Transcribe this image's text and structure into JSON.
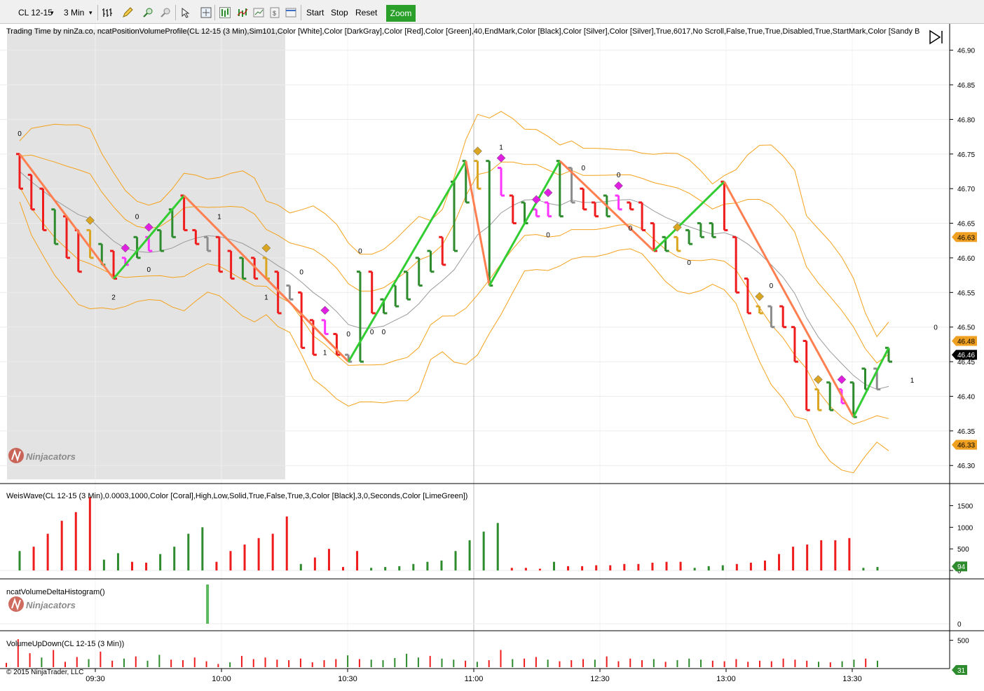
{
  "toolbar": {
    "instrument": "CL 12-15",
    "timeframe": "3 Min",
    "buttons": [
      {
        "name": "start-button",
        "label": "Start"
      },
      {
        "name": "stop-button",
        "label": "Stop"
      },
      {
        "name": "reset-button",
        "label": "Reset"
      },
      {
        "name": "zoom-button",
        "label": "Zoom"
      }
    ],
    "icons": [
      "bar-type-icon",
      "drawing-pencil-icon",
      "zoom-in-icon",
      "zoom-out-icon",
      "cursor-icon",
      "crosshair-icon",
      "chart-style-icon",
      "indicators-icon",
      "strategies-icon",
      "data-box-icon",
      "properties-icon"
    ]
  },
  "panels": {
    "price_title": "Trading Time by ninZa.co, ncatPositionVolumeProfile(CL 12-15 (3 Min),Sim101,Color [White],Color [DarkGray],Color [Red],Color [Green],40,EndMark,Color [Black],Color [Silver],Color [Silver],True,6017,No Scroll,False,True,True,Disabled,True,StartMark,Color [Sandy B",
    "weis_title": "WeisWave(CL 12-15 (3 Min),0.0003,1000,Color [Coral],High,Low,Solid,True,False,True,3,Color [Black],3,0,Seconds,Color [LimeGreen])",
    "delta_title": "ncatVolumeDeltaHistogram()",
    "updown_title": "VolumeUpDown(CL 12-15 (3 Min))",
    "watermark": "Ninjacators",
    "copyright": "© 2015 NinjaTrader, LLC"
  },
  "colors": {
    "up": "#2e8b2e",
    "down": "#ee1c1c",
    "wave_up": "#32cd32",
    "wave_down": "#ff7f50",
    "band": "#f4a21c",
    "ma": "#9a9a9a",
    "gold": "#daa520",
    "magenta": "#ff33ff",
    "gray": "#8c8c8c",
    "session_shade": "#e3e3e3"
  },
  "chart_data": [
    {
      "type": "ohlc",
      "name": "price",
      "x_labels": [
        "09:30",
        "10:00",
        "10:30",
        "11:00",
        "12:30",
        "13:00",
        "13:30"
      ],
      "y_ticks": [
        46.3,
        46.35,
        46.4,
        46.45,
        46.5,
        46.55,
        46.6,
        46.65,
        46.7,
        46.75,
        46.8,
        46.85,
        46.9
      ],
      "y_range": [
        46.28,
        46.93
      ],
      "price_markers": [
        {
          "label": "46.63",
          "value": 46.63,
          "style": "gold"
        },
        {
          "label": "46.48",
          "value": 46.48,
          "style": "gold"
        },
        {
          "label": "46.46",
          "value": 46.46,
          "style": "dark"
        },
        {
          "label": "46.33",
          "value": 46.33,
          "style": "gold"
        }
      ],
      "bars": [
        {
          "h": 46.75,
          "l": 46.7,
          "c": "red"
        },
        {
          "h": 46.72,
          "l": 46.67,
          "c": "red"
        },
        {
          "h": 46.7,
          "l": 46.64,
          "c": "red"
        },
        {
          "h": 46.67,
          "l": 46.62,
          "c": "green"
        },
        {
          "h": 46.66,
          "l": 46.6,
          "c": "red"
        },
        {
          "h": 46.64,
          "l": 46.58,
          "c": "red"
        },
        {
          "h": 46.64,
          "l": 46.6,
          "c": "gold"
        },
        {
          "h": 46.62,
          "l": 46.59,
          "c": "green"
        },
        {
          "h": 46.61,
          "l": 46.57,
          "c": "red"
        },
        {
          "h": 46.6,
          "l": 46.59,
          "c": "magenta"
        },
        {
          "h": 46.63,
          "l": 46.6,
          "c": "green"
        },
        {
          "h": 46.63,
          "l": 46.61,
          "c": "magenta"
        },
        {
          "h": 46.64,
          "l": 46.61,
          "c": "green"
        },
        {
          "h": 46.67,
          "l": 46.63,
          "c": "green"
        },
        {
          "h": 46.69,
          "l": 46.64,
          "c": "red"
        },
        {
          "h": 46.64,
          "l": 46.62,
          "c": "red"
        },
        {
          "h": 46.63,
          "l": 46.61,
          "c": "gray"
        },
        {
          "h": 46.63,
          "l": 46.58,
          "c": "red"
        },
        {
          "h": 46.61,
          "l": 46.57,
          "c": "red"
        },
        {
          "h": 46.6,
          "l": 46.57,
          "c": "green"
        },
        {
          "h": 46.6,
          "l": 46.57,
          "c": "red"
        },
        {
          "h": 46.6,
          "l": 46.57,
          "c": "gold"
        },
        {
          "h": 46.58,
          "l": 46.52,
          "c": "red"
        },
        {
          "h": 46.56,
          "l": 46.54,
          "c": "gray"
        },
        {
          "h": 46.55,
          "l": 46.47,
          "c": "red"
        },
        {
          "h": 46.51,
          "l": 46.46,
          "c": "red"
        },
        {
          "h": 46.51,
          "l": 46.49,
          "c": "magenta"
        },
        {
          "h": 46.49,
          "l": 46.46,
          "c": "red"
        },
        {
          "h": 46.46,
          "l": 46.45,
          "c": "gray"
        },
        {
          "h": 46.58,
          "l": 46.45,
          "c": "green"
        },
        {
          "h": 46.58,
          "l": 46.52,
          "c": "red"
        },
        {
          "h": 46.54,
          "l": 46.52,
          "c": "green"
        },
        {
          "h": 46.56,
          "l": 46.53,
          "c": "green"
        },
        {
          "h": 46.58,
          "l": 46.54,
          "c": "green"
        },
        {
          "h": 46.6,
          "l": 46.56,
          "c": "green"
        },
        {
          "h": 46.61,
          "l": 46.58,
          "c": "green"
        },
        {
          "h": 46.63,
          "l": 46.59,
          "c": "red"
        },
        {
          "h": 46.71,
          "l": 46.61,
          "c": "green"
        },
        {
          "h": 46.74,
          "l": 46.68,
          "c": "green"
        },
        {
          "h": 46.74,
          "l": 46.7,
          "c": "gold"
        },
        {
          "h": 46.74,
          "l": 46.56,
          "c": "green"
        },
        {
          "h": 46.73,
          "l": 46.69,
          "c": "magenta"
        },
        {
          "h": 46.69,
          "l": 46.65,
          "c": "red"
        },
        {
          "h": 46.68,
          "l": 46.65,
          "c": "green"
        },
        {
          "h": 46.67,
          "l": 46.66,
          "c": "magenta"
        },
        {
          "h": 46.68,
          "l": 46.66,
          "c": "magenta"
        },
        {
          "h": 46.74,
          "l": 46.66,
          "c": "green"
        },
        {
          "h": 46.73,
          "l": 46.68,
          "c": "gray"
        },
        {
          "h": 46.7,
          "l": 46.67,
          "c": "red"
        },
        {
          "h": 46.68,
          "l": 46.66,
          "c": "red"
        },
        {
          "h": 46.69,
          "l": 46.66,
          "c": "green"
        },
        {
          "h": 46.69,
          "l": 46.67,
          "c": "magenta"
        },
        {
          "h": 46.68,
          "l": 46.67,
          "c": "red"
        },
        {
          "h": 46.68,
          "l": 46.64,
          "c": "red"
        },
        {
          "h": 46.65,
          "l": 46.61,
          "c": "red"
        },
        {
          "h": 46.63,
          "l": 46.61,
          "c": "green"
        },
        {
          "h": 46.63,
          "l": 46.61,
          "c": "gold"
        },
        {
          "h": 46.64,
          "l": 46.62,
          "c": "green"
        },
        {
          "h": 46.65,
          "l": 46.63,
          "c": "green"
        },
        {
          "h": 46.65,
          "l": 46.63,
          "c": "green"
        },
        {
          "h": 46.71,
          "l": 46.64,
          "c": "red"
        },
        {
          "h": 46.63,
          "l": 46.55,
          "c": "red"
        },
        {
          "h": 46.57,
          "l": 46.52,
          "c": "red"
        },
        {
          "h": 46.53,
          "l": 46.52,
          "c": "gold"
        },
        {
          "h": 46.53,
          "l": 46.5,
          "c": "gray"
        },
        {
          "h": 46.53,
          "l": 46.5,
          "c": "red"
        },
        {
          "h": 46.5,
          "l": 46.45,
          "c": "red"
        },
        {
          "h": 46.48,
          "l": 46.38,
          "c": "red"
        },
        {
          "h": 46.41,
          "l": 46.38,
          "c": "gold"
        },
        {
          "h": 46.42,
          "l": 46.38,
          "c": "green"
        },
        {
          "h": 46.41,
          "l": 46.39,
          "c": "magenta"
        },
        {
          "h": 46.42,
          "l": 46.37,
          "c": "green"
        },
        {
          "h": 46.44,
          "l": 46.41,
          "c": "green"
        },
        {
          "h": 46.44,
          "l": 46.41,
          "c": "gray"
        },
        {
          "h": 46.47,
          "l": 46.45,
          "c": "green"
        }
      ],
      "wave_counts": [
        {
          "bar": 0,
          "label": "0",
          "pos": "above"
        },
        {
          "bar": 8,
          "label": "2",
          "pos": "below"
        },
        {
          "bar": 10,
          "label": "0",
          "pos": "above"
        },
        {
          "bar": 11,
          "label": "0",
          "pos": "below"
        },
        {
          "bar": 17,
          "label": "1",
          "pos": "above"
        },
        {
          "bar": 26,
          "label": "1",
          "pos": "below"
        },
        {
          "bar": 29,
          "label": "0",
          "pos": "above"
        },
        {
          "bar": 24,
          "label": "0",
          "pos": "above"
        },
        {
          "bar": 31,
          "label": "0",
          "pos": "below"
        },
        {
          "bar": 28,
          "label": "0",
          "pos": "above"
        },
        {
          "bar": 30,
          "label": "0",
          "pos": "below"
        },
        {
          "bar": 41,
          "label": "1",
          "pos": "above"
        },
        {
          "bar": 45,
          "label": "0",
          "pos": "below"
        },
        {
          "bar": 48,
          "label": "0",
          "pos": "above"
        },
        {
          "bar": 51,
          "label": "0",
          "pos": "above"
        },
        {
          "bar": 52,
          "label": "0",
          "pos": "below"
        },
        {
          "bar": 57,
          "label": "0",
          "pos": "below"
        },
        {
          "bar": 64,
          "label": "0",
          "pos": "above"
        },
        {
          "bar": 76,
          "label": "1",
          "pos": "below"
        },
        {
          "bar": 78,
          "label": "0",
          "pos": "above"
        },
        {
          "bar": 21,
          "label": "1",
          "pos": "below"
        }
      ]
    },
    {
      "type": "bar",
      "name": "WeisWave",
      "y_ticks": [
        0,
        500,
        1000,
        1500
      ],
      "value_marker": 94,
      "values": [
        {
          "v": 450,
          "c": "green"
        },
        {
          "v": 550,
          "c": "red"
        },
        {
          "v": 850,
          "c": "red"
        },
        {
          "v": 1150,
          "c": "red"
        },
        {
          "v": 1350,
          "c": "red"
        },
        {
          "v": 1700,
          "c": "red"
        },
        {
          "v": 250,
          "c": "green"
        },
        {
          "v": 400,
          "c": "green"
        },
        {
          "v": 200,
          "c": "red"
        },
        {
          "v": 180,
          "c": "red"
        },
        {
          "v": 380,
          "c": "green"
        },
        {
          "v": 550,
          "c": "green"
        },
        {
          "v": 850,
          "c": "green"
        },
        {
          "v": 1000,
          "c": "green"
        },
        {
          "v": 200,
          "c": "red"
        },
        {
          "v": 450,
          "c": "red"
        },
        {
          "v": 600,
          "c": "red"
        },
        {
          "v": 750,
          "c": "red"
        },
        {
          "v": 850,
          "c": "red"
        },
        {
          "v": 1250,
          "c": "red"
        },
        {
          "v": 150,
          "c": "green"
        },
        {
          "v": 300,
          "c": "red"
        },
        {
          "v": 500,
          "c": "red"
        },
        {
          "v": 80,
          "c": "red"
        },
        {
          "v": 450,
          "c": "red"
        },
        {
          "v": 60,
          "c": "green"
        },
        {
          "v": 80,
          "c": "green"
        },
        {
          "v": 100,
          "c": "green"
        },
        {
          "v": 150,
          "c": "green"
        },
        {
          "v": 200,
          "c": "green"
        },
        {
          "v": 230,
          "c": "green"
        },
        {
          "v": 450,
          "c": "green"
        },
        {
          "v": 700,
          "c": "green"
        },
        {
          "v": 900,
          "c": "green"
        },
        {
          "v": 1100,
          "c": "green"
        },
        {
          "v": 60,
          "c": "red"
        },
        {
          "v": 60,
          "c": "red"
        },
        {
          "v": 40,
          "c": "red"
        },
        {
          "v": 200,
          "c": "green"
        },
        {
          "v": 100,
          "c": "red"
        },
        {
          "v": 100,
          "c": "red"
        },
        {
          "v": 120,
          "c": "red"
        },
        {
          "v": 120,
          "c": "red"
        },
        {
          "v": 150,
          "c": "red"
        },
        {
          "v": 150,
          "c": "red"
        },
        {
          "v": 180,
          "c": "red"
        },
        {
          "v": 200,
          "c": "red"
        },
        {
          "v": 200,
          "c": "red"
        },
        {
          "v": 60,
          "c": "green"
        },
        {
          "v": 100,
          "c": "green"
        },
        {
          "v": 120,
          "c": "green"
        },
        {
          "v": 150,
          "c": "red"
        },
        {
          "v": 180,
          "c": "red"
        },
        {
          "v": 230,
          "c": "red"
        },
        {
          "v": 380,
          "c": "red"
        },
        {
          "v": 550,
          "c": "red"
        },
        {
          "v": 600,
          "c": "red"
        },
        {
          "v": 700,
          "c": "red"
        },
        {
          "v": 700,
          "c": "red"
        },
        {
          "v": 750,
          "c": "red"
        },
        {
          "v": 60,
          "c": "green"
        },
        {
          "v": 80,
          "c": "green"
        }
      ]
    },
    {
      "type": "bar",
      "name": "ncatVolumeDeltaHistogram",
      "y_ticks": [
        0
      ],
      "values": [
        {
          "index": 16,
          "v": 1
        }
      ]
    },
    {
      "type": "bar",
      "name": "VolumeUpDown",
      "y_ticks": [
        500
      ],
      "value_marker": 31,
      "values": [
        80,
        520,
        260,
        180,
        320,
        100,
        190,
        150,
        290,
        120,
        160,
        200,
        120,
        230,
        140,
        130,
        180,
        110,
        60,
        90,
        210,
        150,
        180,
        140,
        130,
        160,
        90,
        130,
        150,
        220,
        150,
        140,
        130,
        170,
        250,
        180,
        210,
        160,
        140,
        120,
        100,
        130,
        320,
        150,
        160,
        190,
        140,
        110,
        130,
        150,
        140,
        200,
        110,
        160,
        130,
        150,
        100,
        130,
        160,
        140,
        120,
        110,
        150,
        100,
        120,
        110,
        160,
        140,
        120,
        100,
        90,
        110,
        140,
        160,
        120
      ]
    }
  ]
}
